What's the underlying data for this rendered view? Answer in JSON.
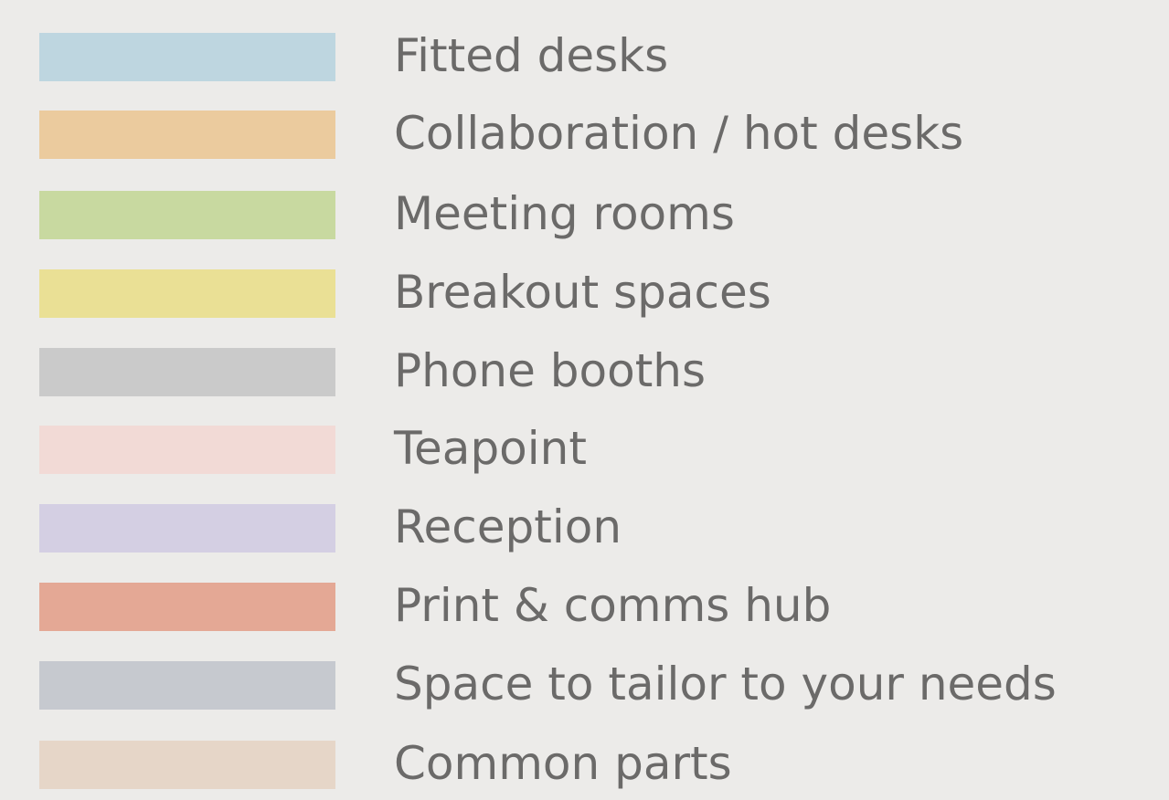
{
  "legend": {
    "items": [
      {
        "label": "Fitted desks",
        "color": "#bed6e0"
      },
      {
        "label": "Collaboration / hot desks",
        "color": "#ebcb9e"
      },
      {
        "label": "Meeting rooms",
        "color": "#c8d9a0"
      },
      {
        "label": "Breakout spaces",
        "color": "#eae095"
      },
      {
        "label": "Phone booths",
        "color": "#cacaca"
      },
      {
        "label": "Teapoint",
        "color": "#f2dad6"
      },
      {
        "label": "Reception",
        "color": "#d4cfe3"
      },
      {
        "label": "Print & comms hub",
        "color": "#e4a895"
      },
      {
        "label": "Space to tailor to your needs",
        "color": "#c6c9cf"
      },
      {
        "label": "Common parts",
        "color": "#e6d6c8"
      }
    ]
  }
}
